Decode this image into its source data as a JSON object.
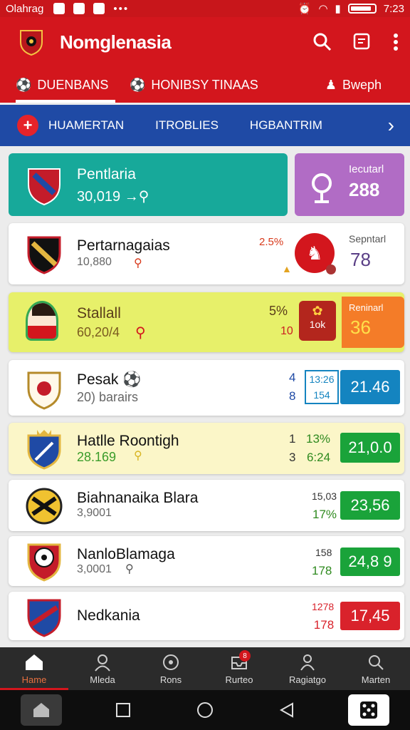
{
  "status": {
    "carrier": "Olahrag",
    "time": "7:23",
    "dots": "•••"
  },
  "appbar": {
    "title": "Nomglenasia"
  },
  "tabs": [
    {
      "label": "DUENBANS"
    },
    {
      "label": "HONIBSY TINAAS"
    },
    {
      "label": "Bweph"
    }
  ],
  "subnav": {
    "items": [
      "HUAMERTAN",
      "ITROBLIES",
      "HGBANTRIM"
    ]
  },
  "hero": {
    "name": "Pentlaria",
    "sub": "30,019",
    "box_label": "Iecutarl",
    "box_value": "288"
  },
  "rows": [
    {
      "name": "Pertarnagaias",
      "sub": "10,880",
      "pct": "2.5%",
      "box_label": "Sepntarl",
      "box_value": "78"
    },
    {
      "name": "Stallall",
      "sub": "60,20/4",
      "pct": "5%",
      "pct2": "10",
      "badge": "1ok",
      "box_label": "Reninarl",
      "box_value": "36"
    },
    {
      "name": "Pesak",
      "sub": "20) barairs",
      "n1": "4",
      "n2": "8",
      "b1": "13:26",
      "b2": "154",
      "odds": "21.46"
    },
    {
      "name": "Hatlle Roontigh",
      "sub": "28.169",
      "n1": "1",
      "n2": "3",
      "b1": "13%",
      "b2": "6:24",
      "odds": "21,0.0"
    },
    {
      "name": "Biahnanaika Blara",
      "sub": "3,9001",
      "b1": "15,03",
      "b2": "17%",
      "odds": "23,56"
    },
    {
      "name": "NanloBlamaga",
      "sub": "3,0001",
      "b1": "158",
      "b2": "178",
      "odds": "24,8 9"
    },
    {
      "name": "Nedkania",
      "b1": "1278",
      "b2": "178",
      "odds": "17,45"
    }
  ],
  "bottomnav": [
    {
      "label": "Hame",
      "icon": "home-icon"
    },
    {
      "label": "Mleda",
      "icon": "person-icon"
    },
    {
      "label": "Rons",
      "icon": "ball-icon"
    },
    {
      "label": "Rurteo",
      "icon": "inbox-icon",
      "badge": "8"
    },
    {
      "label": "Ragiatgo",
      "icon": "user-icon"
    },
    {
      "label": "Marten",
      "icon": "search-icon"
    }
  ],
  "colors": {
    "primary": "#d3161d",
    "accent_blue": "#1f4aa5",
    "teal": "#17a99a",
    "purple": "#b16cc5",
    "odds_blue": "#1484c0",
    "odds_green": "#1aa33a",
    "odds_red": "#d9222b"
  }
}
